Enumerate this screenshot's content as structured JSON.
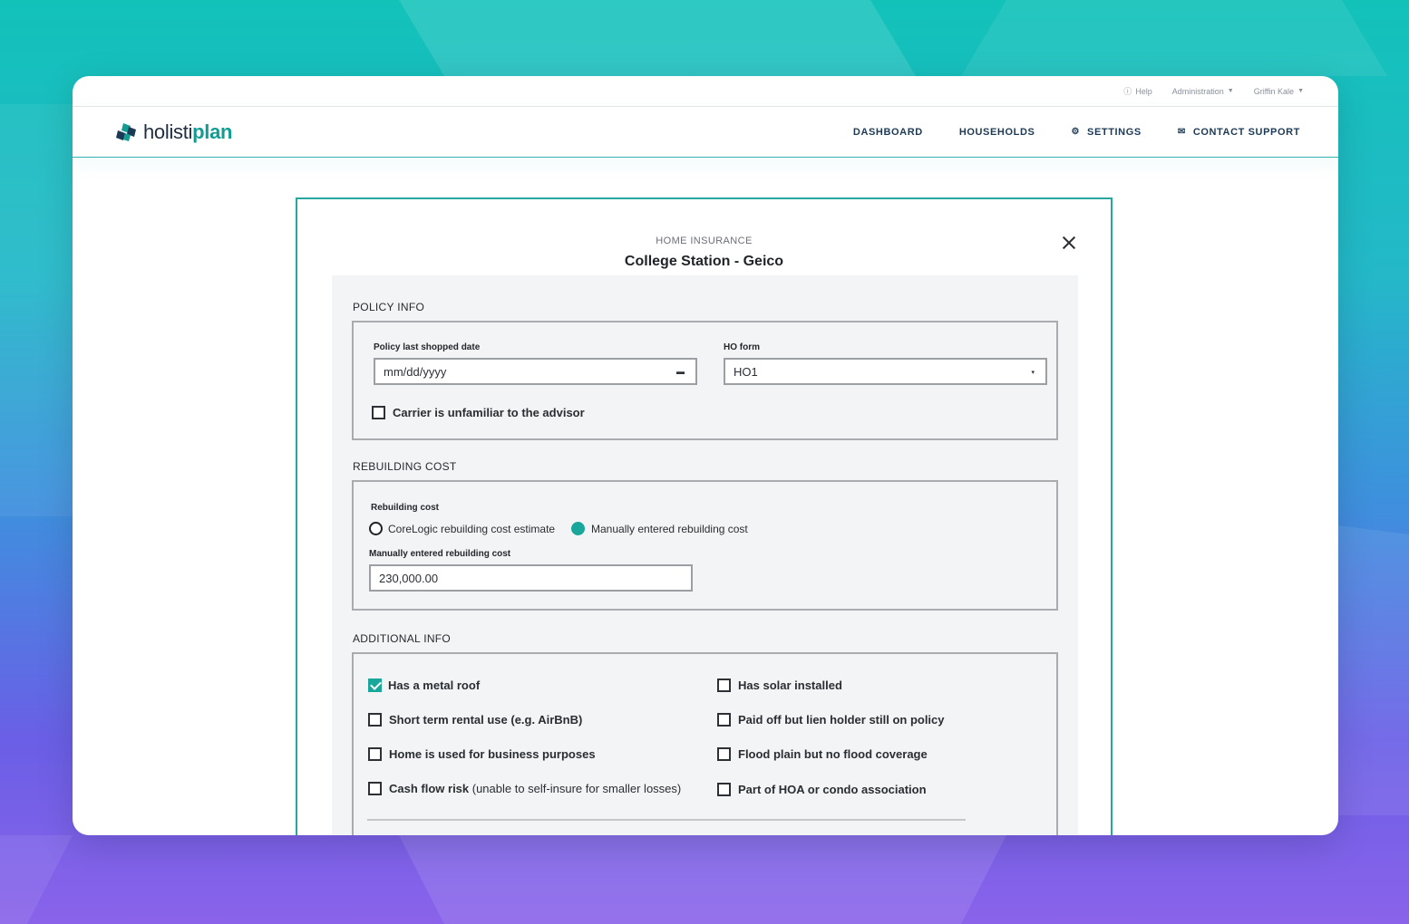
{
  "topbar": {
    "help": "Help",
    "admin": "Administration",
    "user": "Griffin Kale"
  },
  "brand": {
    "name_part1": "holisti",
    "name_part2": "plan"
  },
  "nav": {
    "dashboard": "DASHBOARD",
    "households": "HOUSEHOLDS",
    "settings": "SETTINGS",
    "contact_support": "CONTACT SUPPORT"
  },
  "modal": {
    "eyebrow": "HOME INSURANCE",
    "title": "College Station - Geico"
  },
  "policy_info": {
    "section_title": "POLICY INFO",
    "last_shopped_label": "Policy last shopped date",
    "last_shopped_value": "mm/dd/yyyy",
    "ho_form_label": "HO form",
    "ho_form_value": "HO1",
    "carrier_unfamiliar_label": "Carrier is unfamiliar to the advisor",
    "carrier_unfamiliar_checked": false
  },
  "rebuilding_cost": {
    "section_title": "REBUILDING COST",
    "group_label": "Rebuilding cost",
    "option_corelogic": "CoreLogic rebuilding cost estimate",
    "option_manual": "Manually entered rebuilding cost",
    "selected": "manual",
    "manual_label": "Manually entered rebuilding cost",
    "manual_value": "230,000.00"
  },
  "additional_info": {
    "section_title": "ADDITIONAL INFO",
    "metal_roof": "Has a metal roof",
    "short_term_rental": "Short term rental use (e.g. AirBnB)",
    "business_use": "Home is used for business purposes",
    "cash_flow_risk_bold": "Cash flow risk",
    "cash_flow_risk_rest": " (unable to self-insure for smaller losses)",
    "solar": "Has solar installed",
    "lien_holder": "Paid off but lien holder still on policy",
    "flood_plain": "Flood plain but no flood coverage",
    "hoa": "Part of HOA or condo association"
  },
  "colors": {
    "accent": "#19a69b",
    "modal_border": "#27a79f",
    "nav_text": "#1c3a55"
  }
}
